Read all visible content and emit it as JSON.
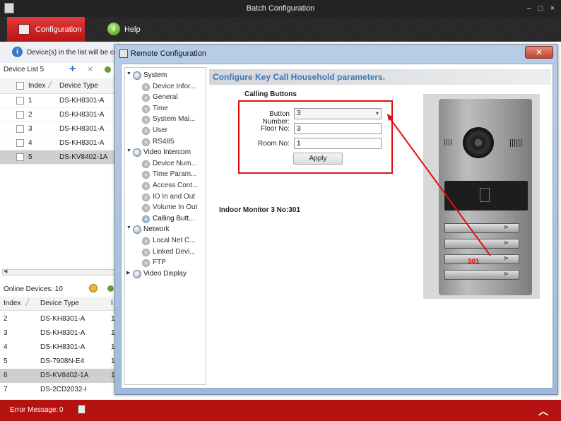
{
  "app": {
    "title": "Batch Configuration",
    "min_label": "–",
    "max_label": "□",
    "close_label": "×"
  },
  "menu": {
    "configuration": "Configuration",
    "help": "Help"
  },
  "info": {
    "text": "Device(s) in the list will be co"
  },
  "device_list": {
    "title": "Device List 5",
    "add_label": "+",
    "remove_label": "×",
    "headers": [
      "Index",
      "Device Type"
    ],
    "rows": [
      {
        "index": "1",
        "type": "DS-KH8301-A"
      },
      {
        "index": "2",
        "type": "DS-KH8301-A"
      },
      {
        "index": "3",
        "type": "DS-KH8301-A"
      },
      {
        "index": "4",
        "type": "DS-KH8301-A"
      },
      {
        "index": "5",
        "type": "DS-KV8402-1A"
      }
    ]
  },
  "online": {
    "title": "Online Devices:  10",
    "headers": [
      "Index",
      "Device Type",
      "I"
    ],
    "rows": [
      {
        "index": "2",
        "type": "DS-KH8301-A",
        "extra": "1"
      },
      {
        "index": "3",
        "type": "DS-KH8301-A",
        "extra": "1"
      },
      {
        "index": "4",
        "type": "DS-KH8301-A",
        "extra": "1"
      },
      {
        "index": "5",
        "type": "DS-7908N-E4",
        "extra": "1"
      },
      {
        "index": "6",
        "type": "DS-KV8402-1A",
        "extra": "1"
      },
      {
        "index": "7",
        "type": "DS-2CD2032-I",
        "extra": ""
      }
    ]
  },
  "status": {
    "error_label": "Error Message:",
    "error_count": "0",
    "collapse_icon": "︿"
  },
  "dialog": {
    "title": "Remote Configuration",
    "close_label": "✕",
    "tree": [
      {
        "label": "System",
        "level": 0,
        "exp": "▼"
      },
      {
        "label": "Device Infor...",
        "level": 1
      },
      {
        "label": "General",
        "level": 1
      },
      {
        "label": "Time",
        "level": 1
      },
      {
        "label": "System Mai...",
        "level": 1
      },
      {
        "label": "User",
        "level": 1
      },
      {
        "label": "RS485",
        "level": 1
      },
      {
        "label": "Video Intercom",
        "level": 0,
        "exp": "▼"
      },
      {
        "label": "Device Num...",
        "level": 1
      },
      {
        "label": "Time Param...",
        "level": 1
      },
      {
        "label": "Access Cont...",
        "level": 1
      },
      {
        "label": "IO In and Out",
        "level": 1
      },
      {
        "label": "Volume In Out",
        "level": 1
      },
      {
        "label": "Calling Butt...",
        "level": 1,
        "selected": true
      },
      {
        "label": "Network",
        "level": 0,
        "exp": "▼"
      },
      {
        "label": "Local Net C...",
        "level": 1
      },
      {
        "label": "Linked Devi...",
        "level": 1
      },
      {
        "label": "FTP",
        "level": 1
      },
      {
        "label": "Video Display",
        "level": 0,
        "exp": "▶"
      }
    ],
    "header": "Configure Key Call Household parameters.",
    "section": "Calling Buttons",
    "button_number_label": "Button Number:",
    "button_number_value": "3",
    "floor_label": "Floor No:",
    "floor_value": "3",
    "room_label": "Room No:",
    "room_value": "1",
    "apply_label": "Apply",
    "indoor_text": "Indoor Monitor 3 No:301",
    "panel_label": "301"
  },
  "colors": {
    "accent_red": "#c81818",
    "header_blue": "#3c78b8",
    "annotation_red": "#e01010"
  }
}
